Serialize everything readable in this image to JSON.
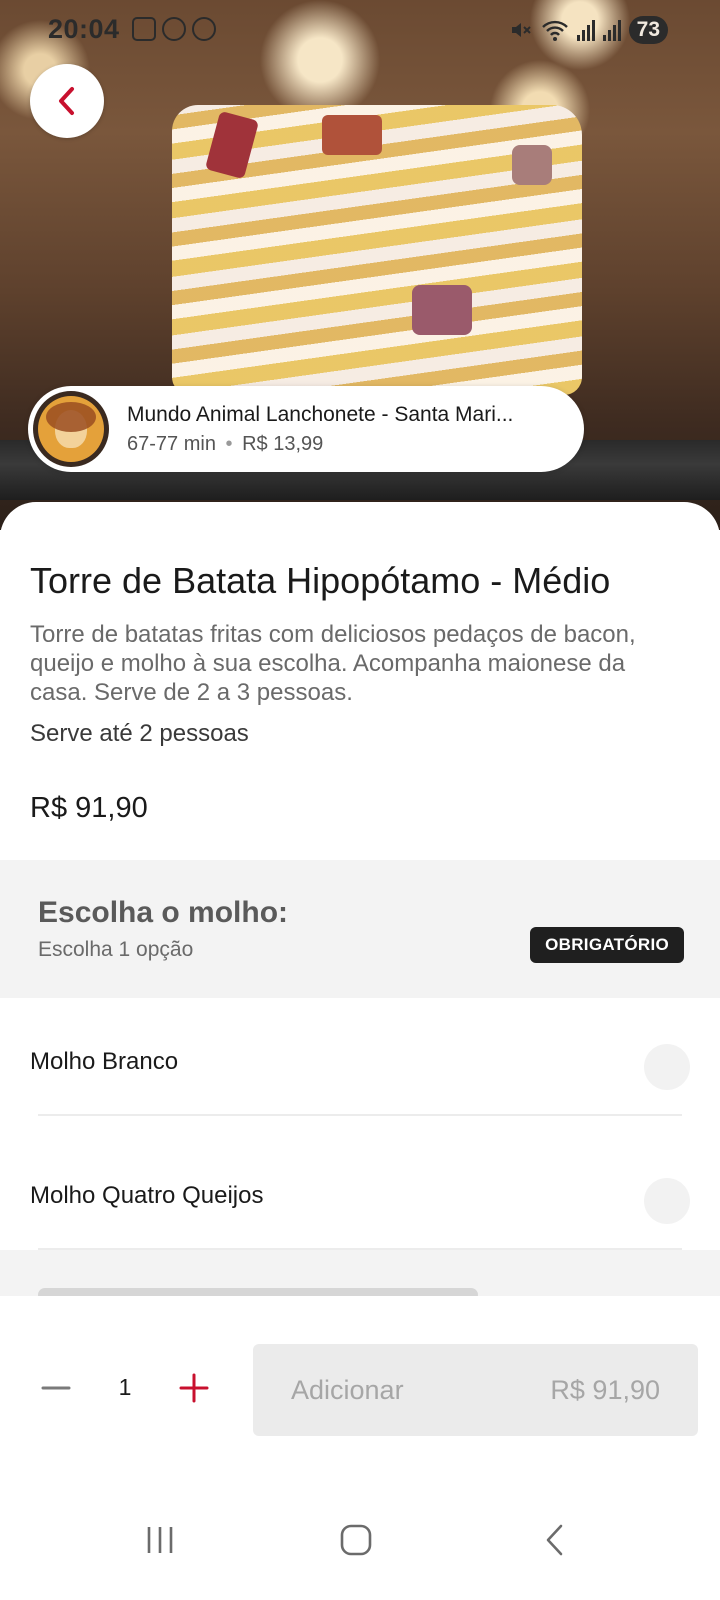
{
  "status_bar": {
    "time": "20:04",
    "battery": "73"
  },
  "restaurant": {
    "name": "Mundo Animal Lanchonete - Santa Mari...",
    "eta": "67-77 min",
    "separator": "•",
    "delivery_fee": "R$ 13,99"
  },
  "product": {
    "title": "Torre de Batata Hipopótamo - Médio",
    "description": "Torre de batatas fritas com deliciosos pedaços de bacon, queijo e molho à sua escolha. Acompanha maionese da casa. Serve de 2 a 3 pessoas.",
    "serves": "Serve até 2 pessoas",
    "price": "R$ 91,90"
  },
  "option_group": {
    "title": "Escolha o molho:",
    "subtitle": "Escolha 1 opção",
    "badge": "OBRIGATÓRIO",
    "options": [
      {
        "label": "Molho Branco",
        "selected": false
      },
      {
        "label": "Molho Quatro Queijos",
        "selected": false
      }
    ]
  },
  "cart": {
    "quantity": "1",
    "add_label": "Adicionar",
    "total": "R$ 91,90"
  },
  "colors": {
    "accent": "#c8102e",
    "badge_bg": "#1f1f1f",
    "disabled_button": "#ebebeb"
  },
  "icons": {
    "back": "chevron-left-icon",
    "minus": "minus-icon",
    "plus": "plus-icon",
    "nav_recents": "recents-icon",
    "nav_home": "home-icon",
    "nav_back": "back-icon"
  }
}
